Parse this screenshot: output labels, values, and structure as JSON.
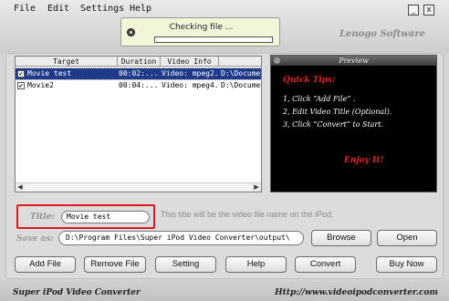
{
  "menu": {
    "file": "File",
    "edit": "Edit",
    "settings": "Settings",
    "help": "Help"
  },
  "window": {
    "minimize_glyph": "_",
    "close_glyph": "x"
  },
  "status": {
    "text": "Checking file ...",
    "progress": 0.0
  },
  "brand": "Lenogo Software",
  "file_list": {
    "columns": [
      "Target",
      "Duration",
      "Video Info",
      ""
    ],
    "rows": [
      {
        "checked": true,
        "selected": true,
        "target": "Movie test",
        "duration": "00:02:...",
        "video_info": "Video: mpeg2...",
        "path": "D:\\Docume"
      },
      {
        "checked": true,
        "selected": false,
        "target": "Movie2",
        "duration": "00:04:...",
        "video_info": "Video: mpeg4...",
        "path": "D:\\Docume"
      }
    ],
    "scroll_left": "◀",
    "scroll_right": "▶"
  },
  "preview": {
    "title": "Preview",
    "tips_title": "Quick Tips:",
    "tips": [
      "1, Click “Add File” .",
      "2, Edit Video Title (Optional).",
      "3, Click “Convert” to Start."
    ],
    "enjoy": "Enjoy It!"
  },
  "title_field": {
    "label": "Title:",
    "value": "Movie test",
    "hint": "This title will be the video file name on the iPod."
  },
  "save_field": {
    "label": "Save as:",
    "value": "D:\\Program Files\\Super iPod Video Converter\\output\\"
  },
  "buttons": {
    "browse": "Browse",
    "open": "Open",
    "add_file": "Add File",
    "remove_file": "Remove File",
    "setting": "Setting",
    "help": "Help",
    "convert": "Convert",
    "buy_now": "Buy Now"
  },
  "footer": {
    "app_name": "Super iPod Video Converter",
    "url": "Http://www.videoipodconverter.com"
  }
}
